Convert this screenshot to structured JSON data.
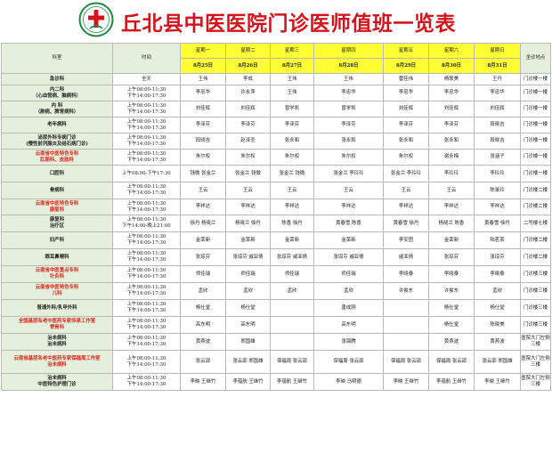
{
  "header": {
    "title": "丘北县中医医院门诊医师值班一览表",
    "logo_color": "#1f8a3c"
  },
  "table": {
    "dept_header": "科室",
    "time_header": "时间",
    "loc_header": "坐诊地点",
    "days": [
      {
        "day": "星期一",
        "date": "8月25日"
      },
      {
        "day": "星期二",
        "date": "8月26日"
      },
      {
        "day": "星期三",
        "date": "8月27日"
      },
      {
        "day": "星期四",
        "date": "8月28日"
      },
      {
        "day": "星期五",
        "date": "8月29日"
      },
      {
        "day": "星期六",
        "date": "8月30日"
      },
      {
        "day": "星期日",
        "date": "8月31日"
      }
    ],
    "rows": [
      {
        "dept": [
          "急诊科"
        ],
        "time": [
          "全天"
        ],
        "docs": [
          "王伟",
          "李成",
          "王伟",
          "王伟",
          "雷佳伟",
          "杨联美",
          "王丹"
        ],
        "loc": [
          "门诊楼一楼"
        ]
      },
      {
        "dept": [
          "内二科",
          "（心血管病、脑病科）"
        ],
        "time": [
          "上午08:00-11:30",
          "下午14:00-17:30"
        ],
        "docs": [
          "李忠华",
          "许永萍",
          "王伟",
          "李忠华",
          "李忠华",
          "李忠华",
          "李忠华"
        ],
        "loc": [
          "门诊楼一楼"
        ]
      },
      {
        "dept": [
          "内 科",
          "（肺病、脾胃病科）"
        ],
        "time": [
          "上午08:00-11:30",
          "下午14:00-17:30"
        ],
        "docs": [
          "刘佳辉",
          "刘佳辉",
          "曾学凯",
          "曾学凯",
          "刘佳辉",
          "刘佳辉",
          "刘佳辉"
        ],
        "loc": [
          "门诊楼一楼"
        ]
      },
      {
        "dept": [
          "老年病科"
        ],
        "time": [
          "上午08:00-11:30",
          "下午14:00-17:30"
        ],
        "docs": [
          "李泽芬",
          "李泽芬",
          "李泽芬",
          "李泽芬",
          "李泽芬",
          "李泽芬",
          "段晓吉"
        ],
        "loc": [
          "门诊楼一楼"
        ]
      },
      {
        "dept": [
          "泌尿外科专病门诊",
          "(慢性前列腺炎及结石病门诊)"
        ],
        "time": [
          "上午08:00-11:30",
          "下午14:00-17:30"
        ],
        "docs": [
          "段晓吉",
          "赵泽圣",
          "张永和",
          "张永和",
          "张永和",
          "张永和",
          "段晓吉"
        ],
        "loc": [
          "门诊楼一楼"
        ]
      },
      {
        "dept": [
          "云南省中医特色专科",
          "肛肠科、皮肤科"
        ],
        "deptRed": true,
        "time": [
          "上午08:00-11:30",
          "下午14:00-17:30"
        ],
        "docs": [
          "朱尔权",
          "朱尔权",
          "朱尔权",
          "朱尔权",
          "朱尔权",
          "谢永梅",
          "张涵子"
        ],
        "loc": [
          "门诊楼一楼"
        ]
      },
      {
        "dept": [
          "口腔科"
        ],
        "time": [
          "上午08:00-下午17:30"
        ],
        "docs": [
          "钱微 张金兰",
          "张金兰 钱微",
          "张金兰 钱微",
          "张金兰 李玲玲",
          "张金兰 李玲玲",
          "李玲玲",
          "李玲玲"
        ],
        "loc": [
          "门诊楼一楼"
        ]
      },
      {
        "dept": [
          "骨病科"
        ],
        "time": [
          "上午08:00-11:30",
          "下午14:00-17:30"
        ],
        "docs": [
          "王云",
          "王云",
          "王云",
          "王云",
          "王云",
          "王云",
          "陈录玲"
        ],
        "loc": [
          "门诊楼二楼"
        ]
      },
      {
        "dept": [
          "云南省中医特色专科",
          "康复科"
        ],
        "deptRed": true,
        "time": [
          "上午08:00-11:30",
          "下午14:00-17:30"
        ],
        "docs": [
          "李祥达",
          "李祥达",
          "李祥达",
          "李祥达",
          "李祥达",
          "李祥达",
          "李祥达"
        ],
        "loc": [
          "门诊楼二楼"
        ]
      },
      {
        "dept": [
          "康复科",
          "治疗区"
        ],
        "time": [
          "上午08:00-11:30",
          "下午14:00-晚上21:00"
        ],
        "docs": [
          "徐丹 杨晓兰",
          "杨晓兰 徐丹",
          "陈香 徐丹",
          "黄春雪 陈香",
          "黄春雪 徐丹",
          "杨晓兰 陈香",
          "黄春雪 徐丹"
        ],
        "loc": [
          "二号楼七楼"
        ]
      },
      {
        "dept": [
          "妇产科"
        ],
        "time": [
          "上午08:00-11:30",
          "下午14:00-17:30"
        ],
        "docs": [
          "金荣新",
          "金荣新",
          "金荣新",
          "金荣新",
          "李安团",
          "金荣新",
          "陆茗茶"
        ],
        "loc": [
          "门诊楼二楼"
        ]
      },
      {
        "dept": [
          "眼耳鼻喉科"
        ],
        "time": [
          "上午08:00-11:30",
          "下午14:00-17:30"
        ],
        "docs": [
          "张琼芬",
          "张琼芬 戚亚倩",
          "张琼芬 戚亚倩",
          "张琼芬 戚亚倩",
          "戚亚倩",
          "张琼芬",
          "张琼芬"
        ],
        "loc": [
          "门诊楼二楼"
        ]
      },
      {
        "dept": [
          "云南省中医重点专科",
          "针灸科"
        ],
        "deptRed": true,
        "time": [
          "上午08:00-11:30",
          "下午14:00-17:30"
        ],
        "docs": [
          "师佳瑞",
          "师佳瑞",
          "师佳瑞",
          "师佳瑞",
          "李晓泰",
          "李晓泰",
          "李晓泰"
        ],
        "loc": [
          "门诊楼三楼"
        ]
      },
      {
        "dept": [
          "云南省中医特色专科",
          "儿科"
        ],
        "deptRed": true,
        "time": [
          "上午08:00-11:30",
          "下午14:00-17:30"
        ],
        "docs": [
          "孟欣",
          "孟欣",
          "孟欣",
          "孟欣",
          "许俊东",
          "许俊东",
          "孟欣"
        ],
        "loc": [
          "门诊楼三楼"
        ]
      },
      {
        "dept": [
          "普通外科/乳甲外科"
        ],
        "time": [
          "上午08:00-11:30",
          "下午14:00-17:30"
        ],
        "docs": [
          "杨仕堂",
          "杨仕堂",
          "",
          "唐成刚",
          "",
          "杨仕堂",
          "杨仕堂"
        ],
        "loc": [
          "门诊楼三楼"
        ]
      },
      {
        "dept": [
          "全国基层名老中医药专家传承工作室",
          "脊骨科"
        ],
        "deptRed": true,
        "time": [
          "上午08:00-11:30",
          "下午14:00-17:30"
        ],
        "docs": [
          "高东明",
          "高东明",
          "",
          "高东明",
          "",
          "杨仕堂",
          "陈晓美"
        ],
        "loc": [
          "门诊楼三楼"
        ]
      },
      {
        "dept": [
          "治未病科",
          "治未病科"
        ],
        "time": [
          "上午08:00-11:30",
          "下午14:00-17:30"
        ],
        "docs": [
          "黄燕波",
          "郑国雄",
          "",
          "张锦腾",
          "",
          "黄燕波",
          "黄燕波"
        ],
        "loc": [
          "医院大门左侧",
          "三楼"
        ]
      },
      {
        "dept": [
          "云南省基层名老中医药专家保福周工作室",
          "治未病科"
        ],
        "deptRed": true,
        "time": [
          "上午08:00-11:30",
          "下午14:00-17:30"
        ],
        "docs": [
          "张云邵",
          "张云邵 郑国雄",
          "保福周 张云邵",
          "保福周 张云邵",
          "保福周 张云邵",
          "保福周 张云邵",
          "张云邵 郑国雄"
        ],
        "loc": [
          "医院大门左侧",
          "三楼"
        ]
      },
      {
        "dept": [
          "治未病科",
          "中医特色护理门诊"
        ],
        "time": [
          "上午08:00-11:30",
          "下午14:00-17:30"
        ],
        "docs": [
          "李映 王继竹",
          "李蕴航 王继竹",
          "李蕴航 王继竹",
          "李映 马明德",
          "李映 王继竹",
          "李蕴航 王继竹",
          "李映 王继竹"
        ],
        "loc": [
          "医院大门左侧",
          "三楼"
        ]
      }
    ]
  }
}
